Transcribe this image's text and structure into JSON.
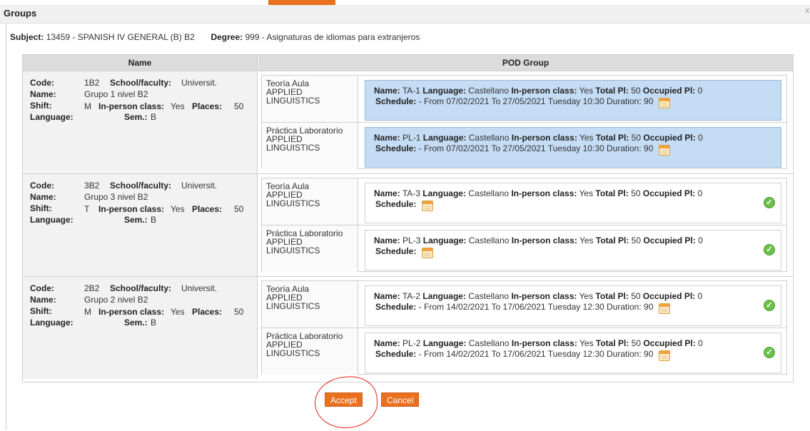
{
  "window": {
    "title": "Groups",
    "close_label": "x"
  },
  "subject": {
    "subject_label": "Subject:",
    "subject_value": "13459 - SPANISH IV GENERAL (B) B2",
    "degree_label": "Degree:",
    "degree_value": "999 - Asignaturas de idiomas para extranjeros"
  },
  "table": {
    "headers": {
      "name": "Name",
      "pod_group": "POD Group"
    },
    "labels": {
      "code": "Code:",
      "name": "Name:",
      "shift": "Shift:",
      "language": "Language:",
      "school": "School/faculty:",
      "inperson": "In-person class:",
      "places": "Places:",
      "sem": "Sem.:"
    },
    "pod_labels": {
      "name": "Name:",
      "language": "Language:",
      "inperson": "In-person class:",
      "total": "Total Pl:",
      "occupied": "Occupied Pl:",
      "schedule": "Schedule:"
    },
    "groups": [
      {
        "code": "1B2",
        "school": "Universit.",
        "name": "Grupo 1 nivel B2",
        "shift": "M",
        "inperson": "Yes",
        "places": "50",
        "language": "",
        "sem": "B",
        "pods": [
          {
            "type_line1": "Teoría Aula",
            "type_line2": "APPLIED",
            "type_line3": "LINGUISTICS",
            "name": "TA-1",
            "language": "Castellano",
            "inperson": "Yes",
            "total": "50",
            "occupied": "0",
            "schedule": "- From 07/02/2021 To 27/05/2021 Tuesday 10:30 Duration: 90",
            "selected": true
          },
          {
            "type_line1": "Práctica Laboratorio",
            "type_line2": "APPLIED",
            "type_line3": "LINGUISTICS",
            "name": "PL-1",
            "language": "Castellano",
            "inperson": "Yes",
            "total": "50",
            "occupied": "0",
            "schedule": "- From 07/02/2021 To 27/05/2021 Tuesday 10:30 Duration: 90",
            "selected": true
          }
        ]
      },
      {
        "code": "3B2",
        "school": "Universit.",
        "name": "Grupo 3 nivel B2",
        "shift": "T",
        "inperson": "Yes",
        "places": "50",
        "language": "",
        "sem": "B",
        "pods": [
          {
            "type_line1": "Teoría Aula",
            "type_line2": "APPLIED",
            "type_line3": "LINGUISTICS",
            "name": "TA-3",
            "language": "Castellano",
            "inperson": "Yes",
            "total": "50",
            "occupied": "0",
            "schedule": "",
            "selected": false
          },
          {
            "type_line1": "Práctica Laboratorio",
            "type_line2": "APPLIED",
            "type_line3": "LINGUISTICS",
            "name": "PL-3",
            "language": "Castellano",
            "inperson": "Yes",
            "total": "50",
            "occupied": "0",
            "schedule": "",
            "selected": false
          }
        ]
      },
      {
        "code": "2B2",
        "school": "Universit.",
        "name": "Grupo 2 nivel B2",
        "shift": "M",
        "inperson": "Yes",
        "places": "50",
        "language": "",
        "sem": "B",
        "pods": [
          {
            "type_line1": "Teoría Aula",
            "type_line2": "APPLIED",
            "type_line3": "LINGUISTICS",
            "name": "TA-2",
            "language": "Castellano",
            "inperson": "Yes",
            "total": "50",
            "occupied": "0",
            "schedule": "- From 14/02/2021 To 17/06/2021 Tuesday 12:30 Duration: 90",
            "selected": false
          },
          {
            "type_line1": "Práctica Laboratorio",
            "type_line2": "APPLIED",
            "type_line3": "LINGUISTICS",
            "name": "PL-2",
            "language": "Castellano",
            "inperson": "Yes",
            "total": "50",
            "occupied": "0",
            "schedule": "- From 14/02/2021 To 17/06/2021 Tuesday 12:30 Duration: 90",
            "selected": false
          }
        ]
      }
    ]
  },
  "buttons": {
    "accept": "Accept",
    "cancel": "Cancel"
  },
  "colors": {
    "accent": "#e8701e",
    "selected_bg": "#c5dcf5",
    "check": "#6cc04a",
    "annotation": "#e2201c"
  },
  "icons": [
    "calendar-icon",
    "check-circle-icon",
    "close-icon"
  ]
}
